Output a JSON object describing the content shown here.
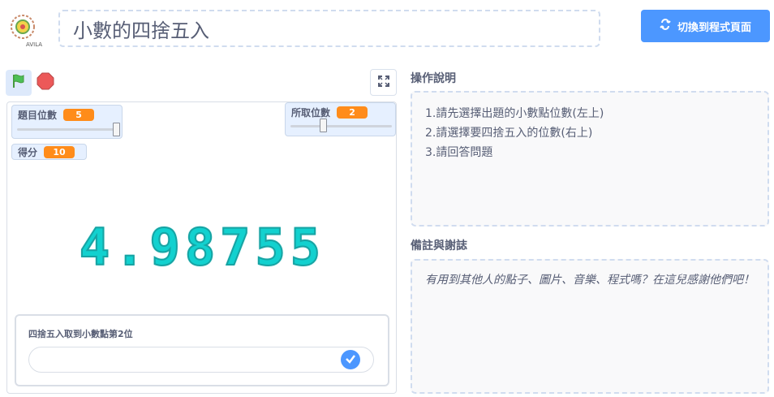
{
  "header": {
    "project_title": "小數的四捨五入",
    "logo_text": "AVILA",
    "switch_button_label": "切換到程式頁面"
  },
  "stage_controls": {
    "green_flag_icon": "green-flag-icon",
    "stop_icon": "stop-sign-icon",
    "fullscreen_icon": "fullscreen-icon"
  },
  "stage": {
    "monitors": [
      {
        "label": "題目位數",
        "value": "5",
        "slider": {
          "min": 1,
          "max": 5,
          "value": 5
        }
      },
      {
        "label": "所取位數",
        "value": "2",
        "slider": {
          "min": 1,
          "max": 5,
          "value": 2
        }
      },
      {
        "label": "得分",
        "value": "10"
      }
    ],
    "display_number": "4.98755",
    "ask": {
      "question": "四捨五入取到小數點第2位",
      "answer_value": ""
    }
  },
  "instructions": {
    "title": "操作說明",
    "items": [
      "1.請先選擇出題的小數點位數(左上)",
      "2.請選擇要四捨五入的位數(右上)",
      "3.請回答問題"
    ]
  },
  "credits": {
    "title": "備註與謝誌",
    "text": "有用到其他人的點子、圖片、音樂、程式嗎？在這兒感謝他們吧！"
  },
  "colors": {
    "accent": "#4c97ff",
    "monitor_value": "#ff8c1a",
    "number_color": "#12d1cf"
  }
}
